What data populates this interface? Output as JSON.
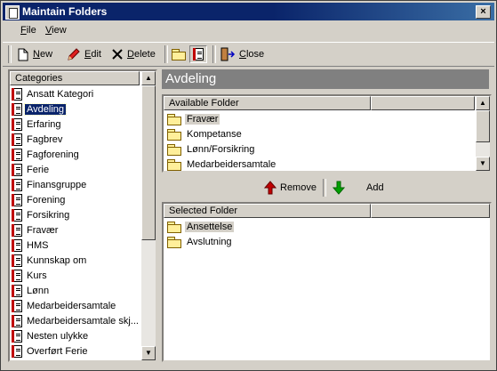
{
  "window": {
    "title": "Maintain Folders",
    "close_glyph": "×"
  },
  "menu": {
    "file": "File",
    "view": "View"
  },
  "toolbar": {
    "new": "New",
    "edit": "Edit",
    "delete": "Delete",
    "close": "Close"
  },
  "categories": {
    "header": "Categories",
    "selected_index": 1,
    "items": [
      "Ansatt Kategori",
      "Avdeling",
      "Erfaring",
      "Fagbrev",
      "Fagforening",
      "Ferie",
      "Finansgruppe",
      "Forening",
      "Forsikring",
      "Fravær",
      "HMS",
      "Kunnskap om",
      "Kurs",
      "Lønn",
      "Medarbeidersamtale",
      "Medarbeidersamtale skj...",
      "Nesten ulykke",
      "Overført Ferie"
    ]
  },
  "detail": {
    "title": "Avdeling"
  },
  "available": {
    "header": "Available Folder",
    "highlighted_index": 0,
    "items": [
      "Fravær",
      "Kompetanse",
      "Lønn/Forsikring",
      "Medarbeidersamtale"
    ]
  },
  "actions": {
    "remove": "Remove",
    "add": "Add"
  },
  "selected": {
    "header": "Selected Folder",
    "highlighted_index": 0,
    "items": [
      "Ansettelse",
      "Avslutning"
    ]
  },
  "colors": {
    "title_bar": "#0a246a",
    "selection": "#0a246a",
    "banner": "#808080",
    "remove_arrow": "#c00000",
    "add_arrow": "#00a000"
  },
  "icons": {
    "new": "new-document-icon",
    "edit": "pencil-icon",
    "delete": "x-delete-icon",
    "folder_view": "folder-icon",
    "list_view": "document-list-icon",
    "close": "door-exit-icon"
  }
}
